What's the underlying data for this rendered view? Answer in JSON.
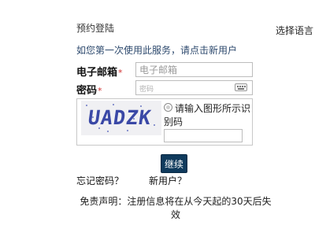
{
  "header": {
    "title": "预约登陆",
    "language_link": "选择语言"
  },
  "intro": {
    "text": "如您第一次使用此服务，请点击新用户"
  },
  "form": {
    "email_label": "电子邮箱",
    "email_placeholder": "电子邮箱",
    "password_label": "密码",
    "password_placeholder": "密码",
    "required_marker": "*",
    "captcha": {
      "image_text": "UADZK",
      "prompt": "请输入图形所示识别码",
      "input_value": ""
    },
    "continue_label": "继续"
  },
  "links": {
    "forgot_password": "忘记密码？",
    "new_user": "新用户？"
  },
  "disclaimer": {
    "text": "免责声明：注册信息将在从今天起的30天后失效"
  },
  "colors": {
    "button_bg": "#0f3a5c",
    "intro_text": "#2e4a6e",
    "required": "#d03030",
    "captcha_text": "#3a48a6"
  },
  "icons": {
    "keyboard": "keyboard-icon",
    "radio": "radio-icon"
  }
}
